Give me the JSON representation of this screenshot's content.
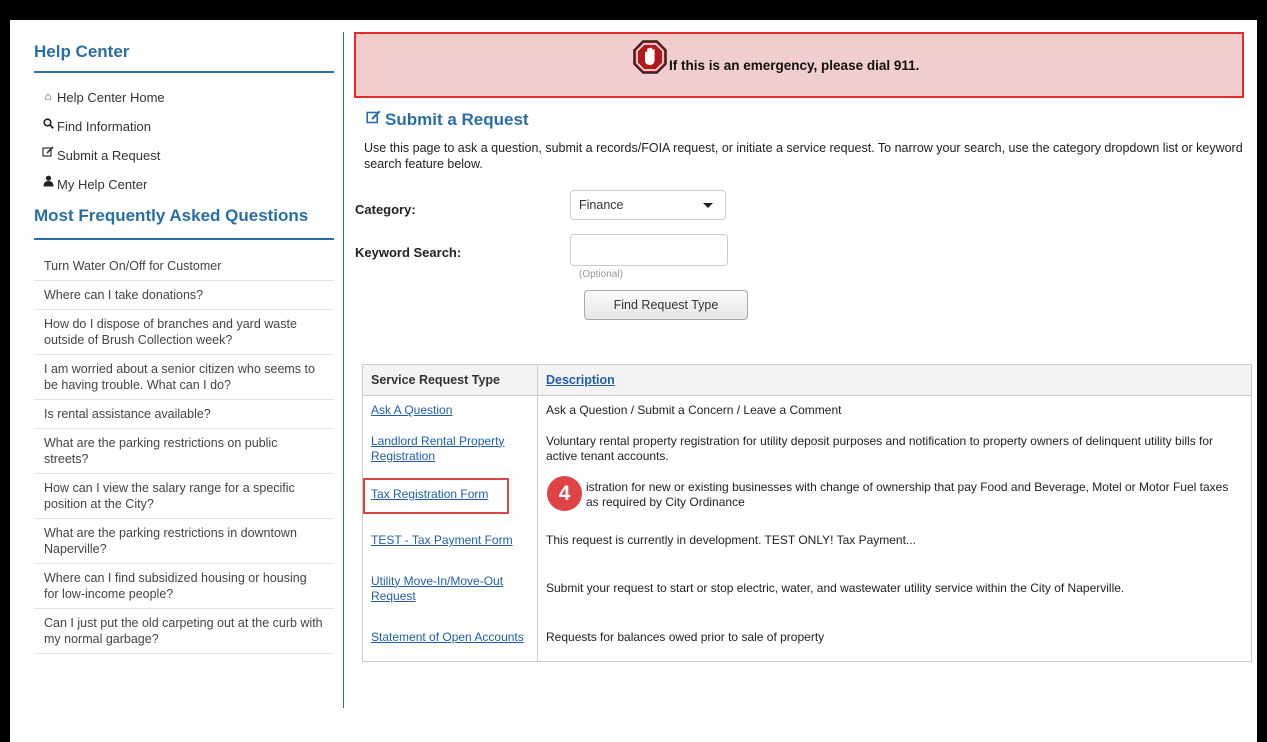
{
  "sidebar": {
    "title": "Help Center",
    "links": [
      {
        "label": "Help Center Home",
        "icon": "home-icon"
      },
      {
        "label": "Find Information",
        "icon": "search-icon"
      },
      {
        "label": "Submit a Request",
        "icon": "edit-icon"
      },
      {
        "label": "My Help Center",
        "icon": "user-icon"
      }
    ],
    "faq_title": "Most Frequently Asked Questions",
    "faq": [
      "Turn Water On/Off for Customer",
      "Where can I take donations?",
      "How do I dispose of branches and yard waste outside of Brush Collection week?",
      "I am worried about a senior citizen who seems to be having trouble. What can I do?",
      "Is rental assistance available?",
      "What are the parking restrictions on public streets?",
      "How can I view the salary range for a specific position at the City?",
      "What are the parking restrictions in downtown Naperville?",
      "Where can I find subsidized housing or housing for low-income people?",
      "Can I just put the old carpeting out at the curb with my normal garbage?"
    ]
  },
  "alert": {
    "text": "If this is an emergency, please dial 911.",
    "icon": "stop-hand-icon"
  },
  "request": {
    "title": "Submit a Request",
    "description": "Use this page to ask a question, submit a records/FOIA request, or initiate a service request. To narrow your search, use the category dropdown list or keyword search feature below.",
    "category_label": "Category:",
    "category_value": "Finance",
    "keyword_label": "Keyword Search:",
    "keyword_value": "",
    "optional_hint": "(Optional)",
    "find_button": "Find Request Type"
  },
  "table": {
    "headers": {
      "type": "Service Request Type",
      "description": "Description"
    },
    "rows": [
      {
        "type": "Ask A Question",
        "description": "Ask a Question / Submit a Concern / Leave a Comment"
      },
      {
        "type": "Landlord Rental Property Registration",
        "description": "Voluntary rental property registration for utility deposit purposes and notification to property owners of delinquent utility bills for active tenant accounts."
      },
      {
        "type": "Tax Registration Form",
        "description": "istration for new or existing businesses with change of ownership that pay Food and Beverage, Motel or Motor Fuel taxes as required by City Ordinance"
      },
      {
        "type": "TEST - Tax Payment Form",
        "description": "This request is currently in development. TEST ONLY! Tax Payment..."
      },
      {
        "type": "Utility Move-In/Move-Out Request",
        "description": "Submit your request to start or stop electric, water, and wastewater utility service within the City of Naperville."
      },
      {
        "type": "Statement of Open Accounts",
        "description": "Requests for balances owed prior to sale of property"
      }
    ]
  },
  "annotation": {
    "badge": "4",
    "color": "#e04343"
  }
}
